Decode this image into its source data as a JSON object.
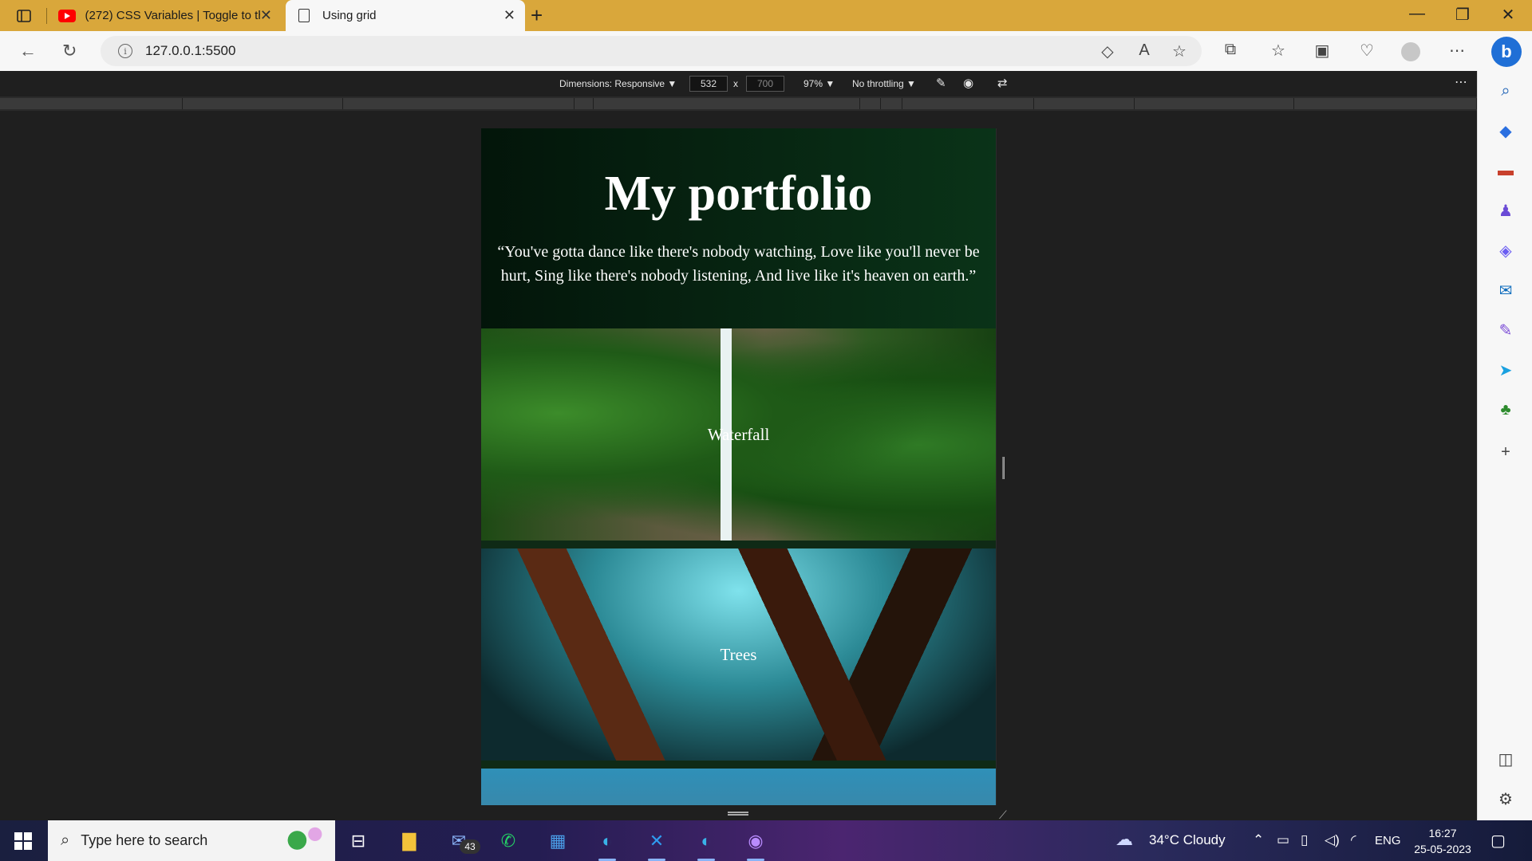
{
  "browser": {
    "tabs": [
      {
        "title": "(272) CSS Variables | Toggle to th",
        "active": false
      },
      {
        "title": "Using grid",
        "active": true
      }
    ],
    "url": "127.0.0.1:5500"
  },
  "devtools": {
    "dimensions_label": "Dimensions: Responsive",
    "width": "532",
    "times": "x",
    "height": "700",
    "zoom": "97%",
    "throttling": "No throttling"
  },
  "page": {
    "title": "My portfolio",
    "quote": "“You've gotta dance like there's nobody watching, Love like you'll never be hurt, Sing like there's nobody listening, And live like it's heaven on earth.”",
    "cards": [
      {
        "label": "Waterfall"
      },
      {
        "label": "Trees"
      }
    ]
  },
  "taskbar": {
    "search_placeholder": "Type here to search",
    "mail_badge": "43",
    "weather": "34°C  Cloudy",
    "language": "ENG",
    "time": "16:27",
    "date": "25-05-2023"
  },
  "colors": {
    "titlebar": "#d9a73b",
    "page_bg": "#0a3318",
    "devtools_bg": "#1f1f1f"
  }
}
